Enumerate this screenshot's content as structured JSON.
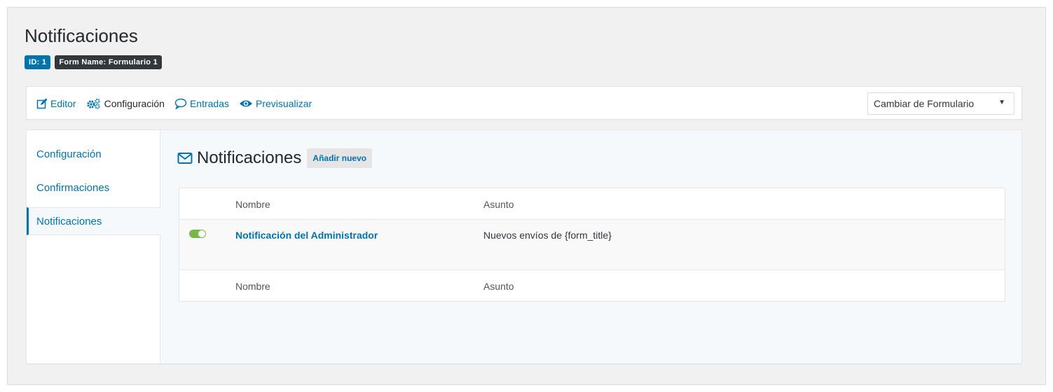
{
  "page": {
    "title": "Notificaciones",
    "badges": {
      "id": "ID: 1",
      "form_name": "Form Name: Formulario 1"
    }
  },
  "toolbar": {
    "links": [
      {
        "label": "Editor",
        "icon": "edit-icon"
      },
      {
        "label": "Configuración",
        "icon": "cogs-icon"
      },
      {
        "label": "Entradas",
        "icon": "comment-icon"
      },
      {
        "label": "Previsualizar",
        "icon": "eye-icon"
      }
    ],
    "active_index": 1,
    "switch_form": {
      "selected": "Cambiar de Formulario"
    }
  },
  "sidebar": {
    "items": [
      {
        "label": "Configuración"
      },
      {
        "label": "Confirmaciones"
      },
      {
        "label": "Notificaciones"
      }
    ],
    "active_index": 2
  },
  "main": {
    "section_title": "Notificaciones",
    "add_new_label": "Añadir nuevo",
    "table": {
      "columns": [
        "Nombre",
        "Asunto"
      ],
      "rows": [
        {
          "active": true,
          "name": "Notificación del Administrador",
          "subject": "Nuevos envíos de {form_title}"
        }
      ]
    }
  },
  "colors": {
    "accent": "#0073aa",
    "toggle_on": "#7ab648",
    "badge_id": "#0073aa",
    "badge_form": "#32373c"
  }
}
